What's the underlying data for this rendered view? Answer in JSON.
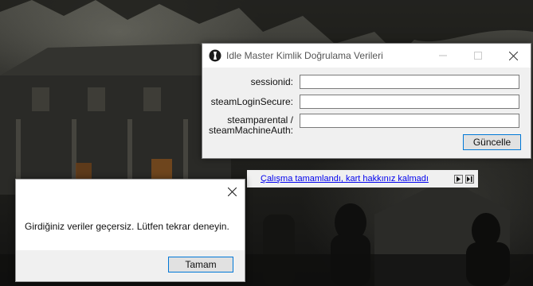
{
  "credentials_window": {
    "title": "Idle Master Kimlik Doğrulama Verileri",
    "fields": [
      {
        "label": "sessionid:",
        "value": ""
      },
      {
        "label": "steamLoginSecure:",
        "value": ""
      },
      {
        "label_line1": "steamparental /",
        "label_line2": "steamMachineAuth:",
        "value": ""
      }
    ],
    "update_button": "Güncelle"
  },
  "main_window_status": {
    "link_text": "Çalışma tamamlandı, kart hakkınız kalmadı",
    "play_icon": "play-icon",
    "skip_icon": "skip-next-icon"
  },
  "message_box": {
    "text": "Girdiğiniz veriler geçersiz. Lütfen tekrar deneyin.",
    "ok_button": "Tamam"
  },
  "colors": {
    "dialog_bg": "#f0f0f0",
    "button_focus_border": "#0078d7",
    "link": "#0000ee"
  }
}
